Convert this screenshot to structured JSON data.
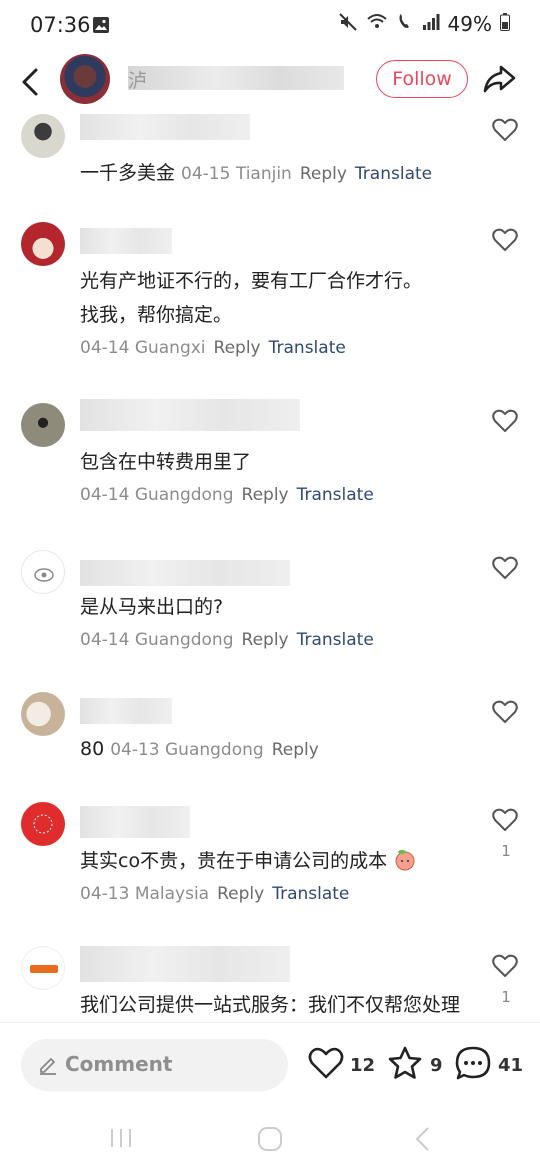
{
  "status_bar": {
    "time": "07:36",
    "battery": "49%"
  },
  "header": {
    "follow_label": "Follow",
    "name_first_char": "泸"
  },
  "comments": [
    {
      "text": "一千多美金",
      "date": "04-15",
      "location": "Tianjin",
      "reply": "Reply",
      "translate": "Translate",
      "likes": ""
    },
    {
      "text_lines": [
        "光有产地证不行的，要有工厂合作才行。",
        "找我，帮你搞定。"
      ],
      "date": "04-14",
      "location": "Guangxi",
      "reply": "Reply",
      "translate": "Translate",
      "likes": ""
    },
    {
      "text": "包含在中转费用里了",
      "date": "04-14",
      "location": "Guangdong",
      "reply": "Reply",
      "translate": "Translate",
      "likes": ""
    },
    {
      "text": "是从马来出口的?",
      "date": "04-14",
      "location": "Guangdong",
      "reply": "Reply",
      "translate": "Translate",
      "likes": ""
    },
    {
      "text": "80",
      "date": "04-13",
      "location": "Guangdong",
      "reply": "Reply",
      "likes": ""
    },
    {
      "text": "其实co不贵，贵在于申请公司的成本",
      "date": "04-13",
      "location": "Malaysia",
      "reply": "Reply",
      "translate": "Translate",
      "likes": "1"
    },
    {
      "text": "我们公司提供一站式服务：我们不仅帮您处理",
      "likes": "1"
    }
  ],
  "footer": {
    "comment_placeholder": "Comment",
    "likes": "12",
    "collects": "9",
    "comments": "41"
  },
  "colors": {
    "accent": "#e8485a",
    "translate": "#2f4a72",
    "meta": "#8c8c8c"
  }
}
